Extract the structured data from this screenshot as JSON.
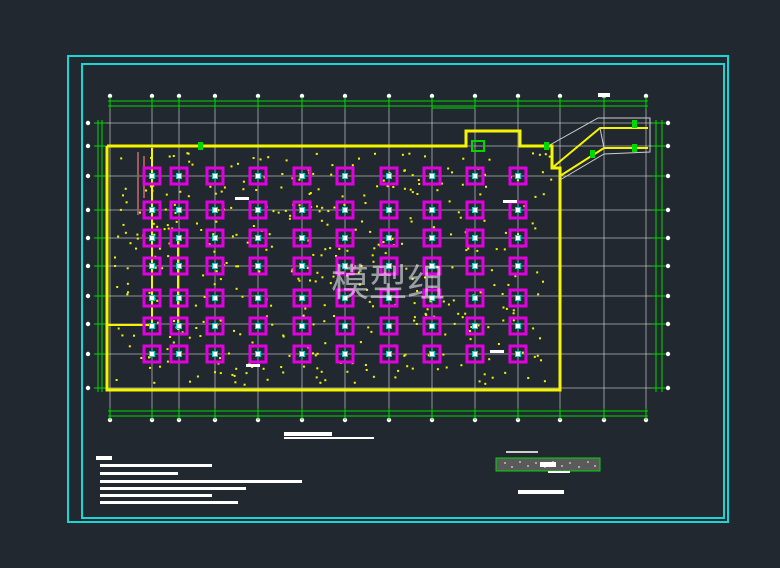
{
  "drawing": {
    "watermark": "模型组",
    "colors": {
      "background": "#212830",
      "frame": "#19d6d6",
      "grid": "#00d900",
      "axis_lines": "#cfcfcf",
      "boundary": "#f5f500",
      "pile_cap": "#e000e0",
      "column_core": "#00d7d7",
      "dots": "#f5f500",
      "notes": "#ffffff"
    },
    "grid": {
      "column_count": 14,
      "row_count": 11
    },
    "pile_caps": {
      "columns": 10,
      "rows": 7
    },
    "notes": {
      "title_bar": "",
      "lines_count": 6
    },
    "detail": {
      "label": ""
    }
  }
}
